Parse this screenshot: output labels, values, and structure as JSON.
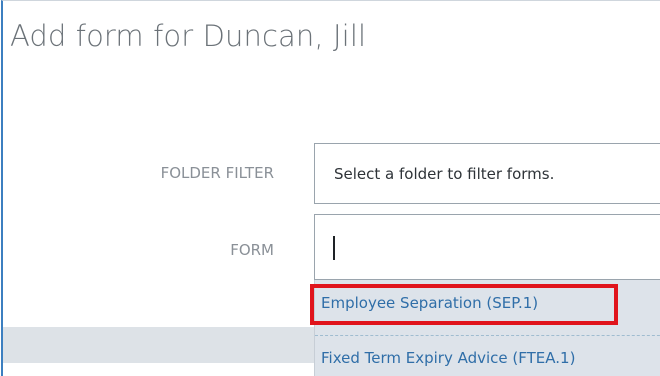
{
  "dialog": {
    "title": "Add form for Duncan, Jill"
  },
  "fields": {
    "folder_filter": {
      "label": "FOLDER FILTER",
      "placeholder": "Select a folder to filter forms."
    },
    "form": {
      "label": "FORM",
      "value": ""
    }
  },
  "dropdown": {
    "options": [
      {
        "label": "Employee Separation (SEP.1)",
        "highlighted": true
      },
      {
        "label": "Fixed Term Expiry Advice (FTEA.1)",
        "highlighted": false
      }
    ]
  },
  "colors": {
    "accent": "#3c7fc0",
    "highlight": "#e0141c",
    "link": "#2f6ea8",
    "dropdown_bg": "#dde3ea"
  }
}
